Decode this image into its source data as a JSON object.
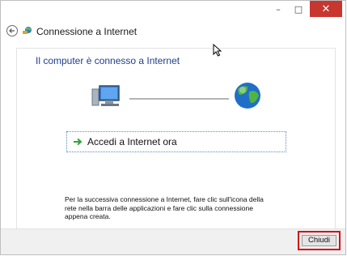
{
  "window": {
    "title_icon": "network-globe-icon",
    "title": "Connessione a Internet",
    "controls": {
      "minimize_glyph": "–",
      "maximize_glyph": "□",
      "close_glyph": "✕"
    }
  },
  "content": {
    "status_text": "Il computer è connesso a Internet",
    "diagram": {
      "left_icon": "computer-icon",
      "right_icon": "globe-icon"
    },
    "action": {
      "icon": "green-arrow-icon",
      "label": "Accedi a Internet ora"
    },
    "info_text": "Per la successiva connessione a Internet, fare clic sull'icona della rete nella barra delle applicazioni e fare clic sulla connessione appena creata."
  },
  "footer": {
    "close_button_label": "Chiudi"
  },
  "colors": {
    "accent_text": "#1e3f8a",
    "close_bg": "#c7372f",
    "highlight_border": "#d90d12"
  }
}
